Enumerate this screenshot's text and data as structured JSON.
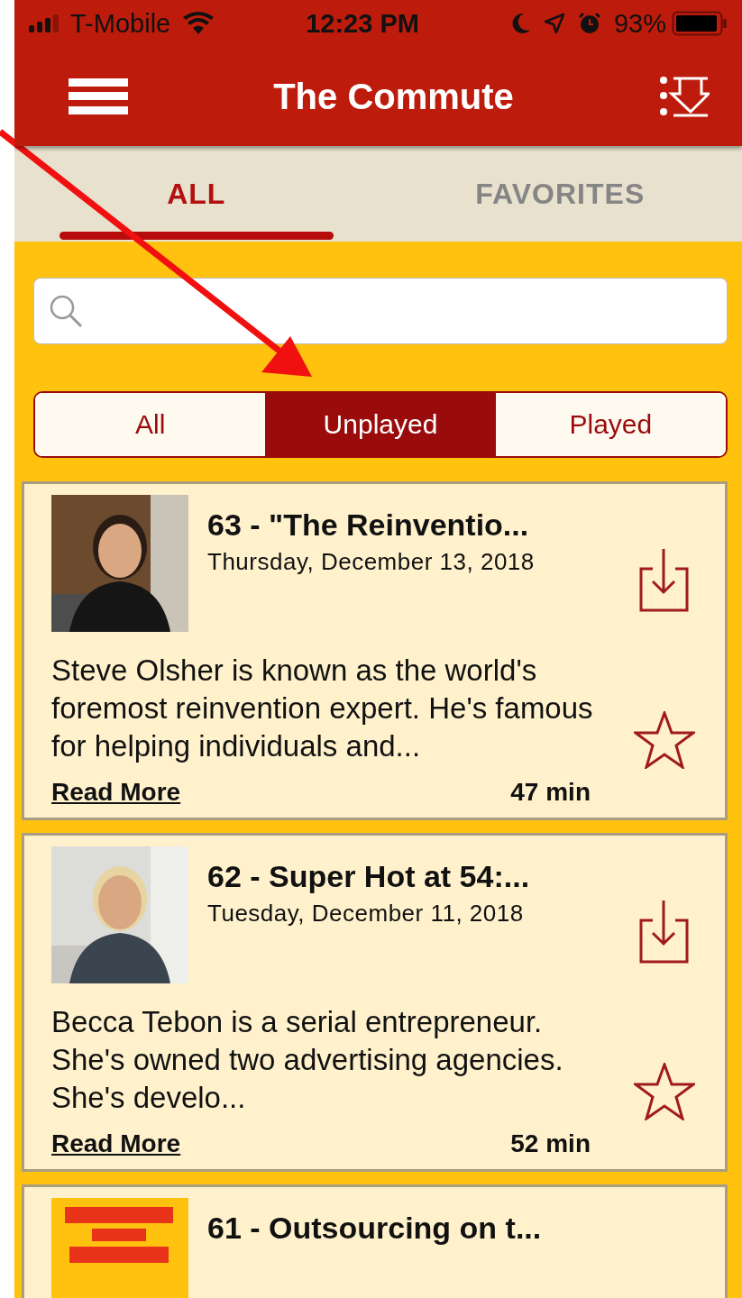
{
  "status_bar": {
    "carrier": "T-Mobile",
    "time": "12:23 PM",
    "battery": "93%"
  },
  "nav": {
    "title": "The Commute"
  },
  "tabs": [
    {
      "label": "ALL",
      "selected": true
    },
    {
      "label": "FAVORITES",
      "selected": false
    }
  ],
  "filter": [
    {
      "label": "All",
      "selected": false
    },
    {
      "label": "Unplayed",
      "selected": true
    },
    {
      "label": "Played",
      "selected": false
    }
  ],
  "episodes": [
    {
      "kind": "picture",
      "title": "63 - \"The Reinventio...",
      "date": "Thursday, December 13, 2018",
      "description": "Steve Olsher is known as the world's foremost reinvention expert. He's famous for helping individuals and...",
      "link": "Read More",
      "duration": "47 min",
      "favorite": false
    },
    {
      "kind": "picture",
      "title": "62 - Super Hot at 54:...",
      "date": "Tuesday, December 11, 2018",
      "description": "Becca Tebon is a serial entrepreneur. She's owned two advertising agencies. She's develo...",
      "link": "Read More",
      "duration": "52 min",
      "favorite": false
    },
    {
      "kind": "picture",
      "title": "61 - Outsourcing on t..."
    }
  ]
}
